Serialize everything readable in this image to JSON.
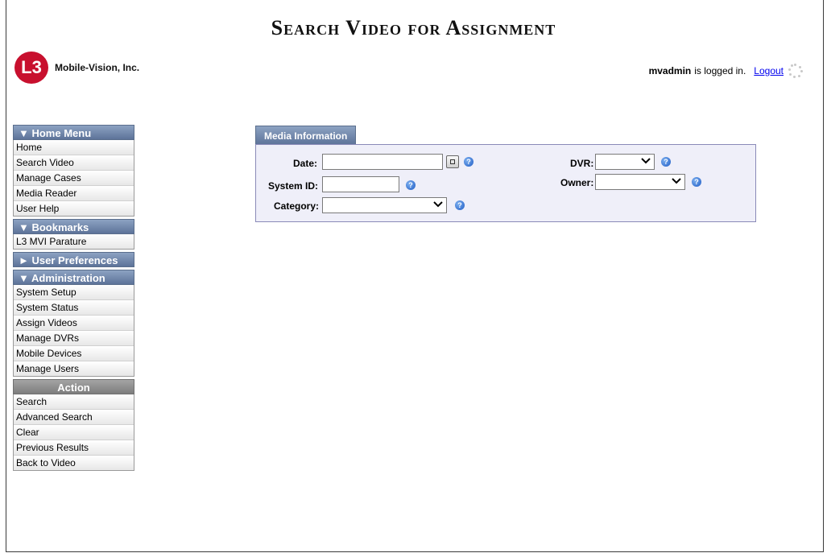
{
  "page": {
    "title": "Search Video for Assignment"
  },
  "logo": {
    "mark": "L3",
    "company": "Mobile-Vision, Inc."
  },
  "login": {
    "user": "mvadmin",
    "text": "is logged in.",
    "logout": "Logout"
  },
  "sidebar": {
    "home_menu": {
      "header": "▼ Home Menu",
      "items": [
        "Home",
        "Search Video",
        "Manage Cases",
        "Media Reader",
        "User Help"
      ]
    },
    "bookmarks": {
      "header": "▼ Bookmarks",
      "items": [
        "L3 MVI Parature"
      ]
    },
    "user_prefs": {
      "header": "► User Preferences"
    },
    "administration": {
      "header": "▼ Administration",
      "items": [
        "System Setup",
        "System Status",
        "Assign Videos",
        "Manage DVRs",
        "Mobile Devices",
        "Manage Users"
      ]
    },
    "action": {
      "header": "Action",
      "items": [
        "Search",
        "Advanced Search",
        "Clear",
        "Previous Results",
        "Back to Video"
      ]
    }
  },
  "form": {
    "tab_label": "Media Information",
    "date_label": "Date:",
    "date_value": "",
    "system_id_label": "System ID:",
    "system_id_value": "",
    "category_label": "Category:",
    "category_value": "",
    "dvr_label": "DVR:",
    "dvr_value": "",
    "owner_label": "Owner:",
    "owner_value": "",
    "help_glyph": "?"
  },
  "colors": {
    "menu_header": "#6f84a8",
    "action_header": "#8a8a8a",
    "panel_bg": "#efeff9",
    "panel_border": "#8a8ab8",
    "help_icon": "#1e5bc4",
    "logo_red": "#c8102e",
    "link": "#0000ee"
  }
}
